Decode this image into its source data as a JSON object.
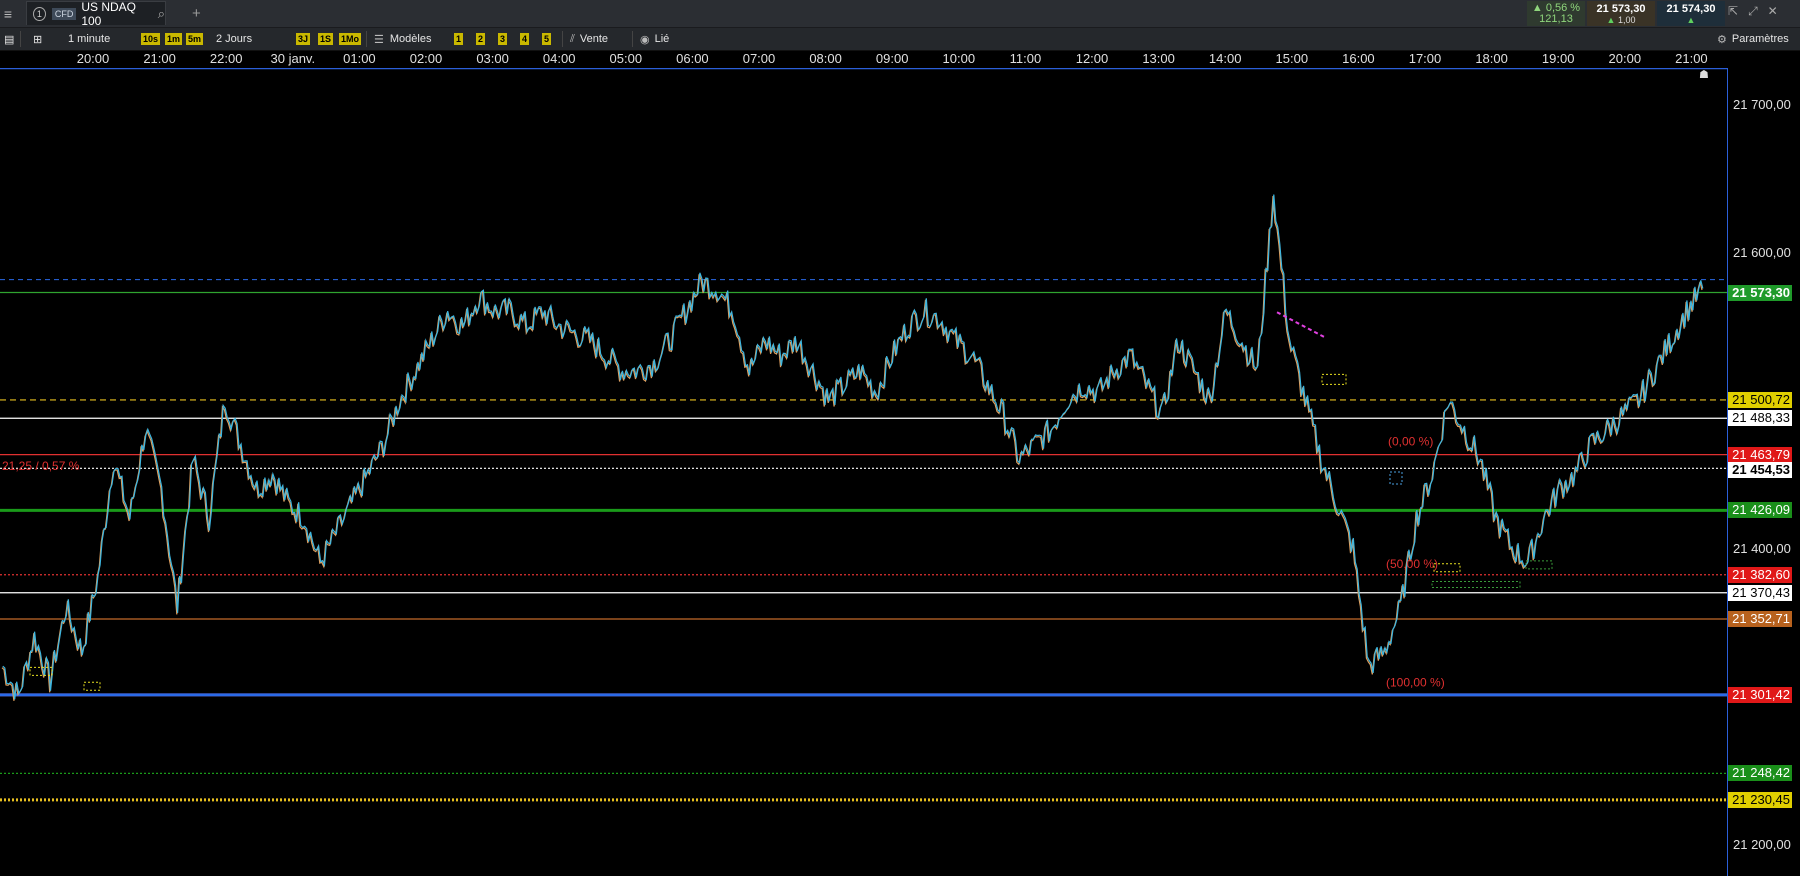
{
  "tab": {
    "number": "1",
    "type": "CFD",
    "instrument": "US NDAQ 100"
  },
  "quote": {
    "change_pct": "▲ 0,56 %",
    "change_abs": "121,13",
    "bid": "21 573,30",
    "ask": "21 574,30",
    "size": "1,00"
  },
  "toolbar": {
    "interval": "1 minute",
    "quick_intervals": [
      "10s",
      "1m",
      "5m"
    ],
    "period": "2 Jours",
    "quick_periods": [
      "3J",
      "1S",
      "1Mo"
    ],
    "models_label": "Modèles",
    "model_slots": [
      "1",
      "2",
      "3",
      "4",
      "5"
    ],
    "sell_label": "Vente",
    "linked_label": "Lié",
    "settings_label": "Paramètres"
  },
  "colors": {
    "up": "#3db6e0",
    "down": "#e0a060",
    "background": "#000000",
    "green_line": "#1a9a1a",
    "blue_line": "#2a6ae8",
    "orange_line": "#c46a2a",
    "red_dotted": "#e03030",
    "yellow_dashed": "#e8c020"
  },
  "chart_data": {
    "type": "line",
    "x_ticks": [
      "20:00",
      "21:00",
      "22:00",
      "30 janv.",
      "01:00",
      "02:00",
      "03:00",
      "04:00",
      "05:00",
      "06:00",
      "07:00",
      "08:00",
      "09:00",
      "10:00",
      "11:00",
      "12:00",
      "13:00",
      "14:00",
      "15:00",
      "16:00",
      "17:00",
      "18:00",
      "19:00",
      "20:00",
      "21:00"
    ],
    "y_ticks": [
      "21 700,00",
      "21 600,00",
      "21 400,00",
      "21 200,00"
    ],
    "ylim": [
      21180,
      21720
    ],
    "series": [
      {
        "values": [
          21320,
          21300,
          21340,
          21310,
          21360,
          21330,
          21380,
          21460,
          21420,
          21480,
          21440,
          21360,
          21460,
          21420,
          21500,
          21470,
          21440,
          21450,
          21430,
          21420,
          21390,
          21410,
          21430,
          21450,
          21470,
          21500,
          21520,
          21540,
          21560,
          21550,
          21570,
          21560,
          21560,
          21550,
          21560,
          21550,
          21545,
          21540,
          21530,
          21520,
          21520,
          21525,
          21540,
          21560,
          21580,
          21575,
          21560,
          21520,
          21540,
          21530,
          21540,
          21520,
          21500,
          21510,
          21520,
          21505,
          21530,
          21550,
          21560,
          21555,
          21540,
          21530,
          21510,
          21490,
          21460,
          21470,
          21480,
          21500,
          21510,
          21505,
          21520,
          21530,
          21510,
          21490,
          21540,
          21520,
          21500,
          21560,
          21540,
          21520,
          21640,
          21540,
          21500,
          21460,
          21430,
          21400,
          21320,
          21330,
          21360,
          21420,
          21450,
          21500,
          21480,
          21460,
          21420,
          21400,
          21390,
          21420,
          21440,
          21450,
          21470,
          21480,
          21490,
          21500,
          21520,
          21540,
          21560,
          21575
        ]
      }
    ],
    "levels": [
      {
        "label": "21 573,30",
        "value": 21573.3,
        "style": "solid",
        "color": "#2fa32f",
        "text_color": "#ffffff"
      },
      {
        "label": "21 500,72",
        "value": 21500.72,
        "style": "dashed",
        "color": "#e8c020",
        "text_color": "#000000"
      },
      {
        "label": "21 488,33",
        "value": 21488.33,
        "style": "solid",
        "color": "#ffffff",
        "text_color": "#000000"
      },
      {
        "label": "21 463,79",
        "value": 21463.79,
        "style": "solid",
        "color": "#e03030",
        "text_color": "#ffffff"
      },
      {
        "label": "21 454,53",
        "value": 21454.53,
        "style": "dotted",
        "color": "#ffffff",
        "text_color": "#000000"
      },
      {
        "label": "21 426,09",
        "value": 21426.09,
        "style": "solid",
        "color": "#1a9a1a",
        "text_color": "#ffffff"
      },
      {
        "label": "21 382,60",
        "value": 21382.6,
        "style": "dotted",
        "color": "#e03030",
        "text_color": "#ffffff"
      },
      {
        "label": "21 370,43",
        "value": 21370.43,
        "style": "solid",
        "color": "#ffffff",
        "text_color": "#000000"
      },
      {
        "label": "21 352,71",
        "value": 21352.71,
        "style": "solid",
        "color": "#c46a2a",
        "text_color": "#ffffff"
      },
      {
        "label": "21 301,42",
        "value": 21301.42,
        "style": "solid",
        "color": "#e03030",
        "text_color": "#ffffff"
      },
      {
        "label": "21 248,42",
        "value": 21248.42,
        "style": "dotted",
        "color": "#1a9a1a",
        "text_color": "#ffffff"
      },
      {
        "label": "21 230,45",
        "value": 21230.45,
        "style": "dotted",
        "color": "#e8c020",
        "text_color": "#000000"
      }
    ],
    "annotations": [
      "21,25 / 0,57 %",
      "(0,00 %)",
      "(50,00 %)",
      "(100,00 %)"
    ]
  }
}
